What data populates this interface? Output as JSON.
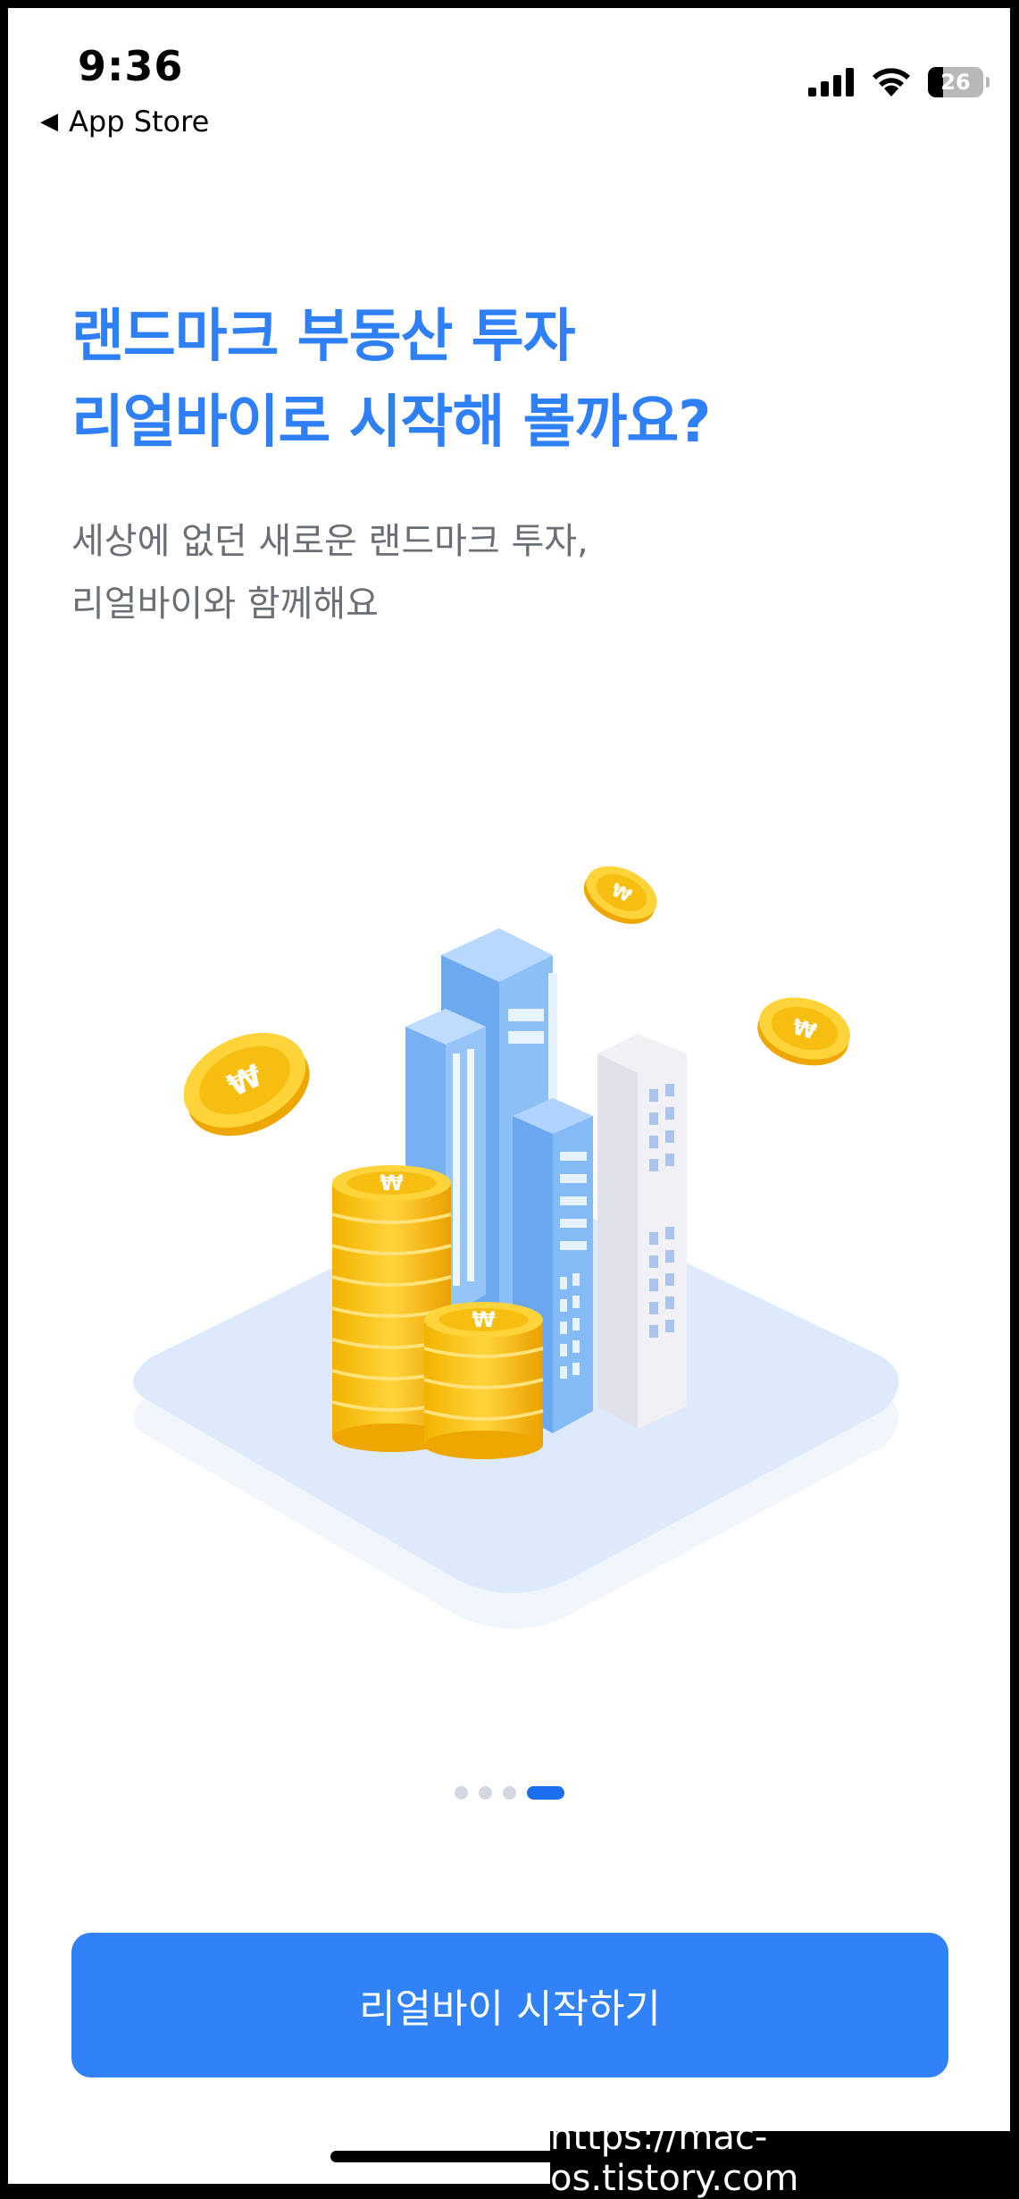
{
  "status_bar": {
    "time": "9:36",
    "back_label": "App Store",
    "battery_level": "26",
    "icons": [
      "cellular-signal-icon",
      "wifi-icon",
      "battery-icon"
    ]
  },
  "onboarding": {
    "headline_line1": "랜드마크 부동산 투자",
    "headline_line2": "리얼바이로 시작해 볼까요?",
    "subtitle_line1": "세상에 없던 새로운 랜드마크 투자,",
    "subtitle_line2": "리얼바이와 함께해요",
    "illustration": "buildings-with-coin-stacks",
    "coin_symbol": "₩",
    "pager": {
      "total": 4,
      "current": 4
    },
    "cta_label": "리얼바이 시작하기"
  },
  "watermark": "https://mac-os.tistory.com",
  "colors": {
    "accent": "#3182f6",
    "headline": "#2f80f6",
    "subtitle": "#6b6f75",
    "pager_active": "#1a6ff0",
    "pager_inactive": "#d3d8e0",
    "coin": "#f6b500"
  }
}
